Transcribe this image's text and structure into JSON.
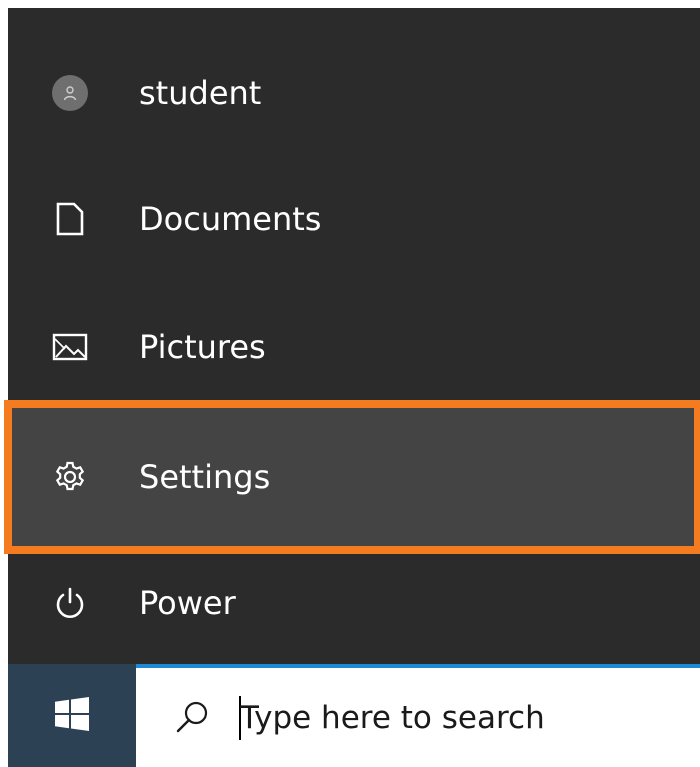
{
  "start_menu": {
    "items": [
      {
        "label": "student",
        "icon": "user-avatar-icon"
      },
      {
        "label": "Documents",
        "icon": "document-icon"
      },
      {
        "label": "Pictures",
        "icon": "pictures-icon"
      },
      {
        "label": "Settings",
        "icon": "gear-icon",
        "highlighted": true
      },
      {
        "label": "Power",
        "icon": "power-icon"
      }
    ],
    "highlight_color": "#f47b20"
  },
  "taskbar": {
    "start_icon": "windows-logo-icon",
    "search": {
      "icon": "search-icon",
      "placeholder": "Type here to search",
      "value": ""
    }
  },
  "colors": {
    "menu_background": "#2b2b2b",
    "selected_background": "#444444",
    "taskbar_background": "#1f2d3a",
    "search_border": "#1f89d6"
  }
}
